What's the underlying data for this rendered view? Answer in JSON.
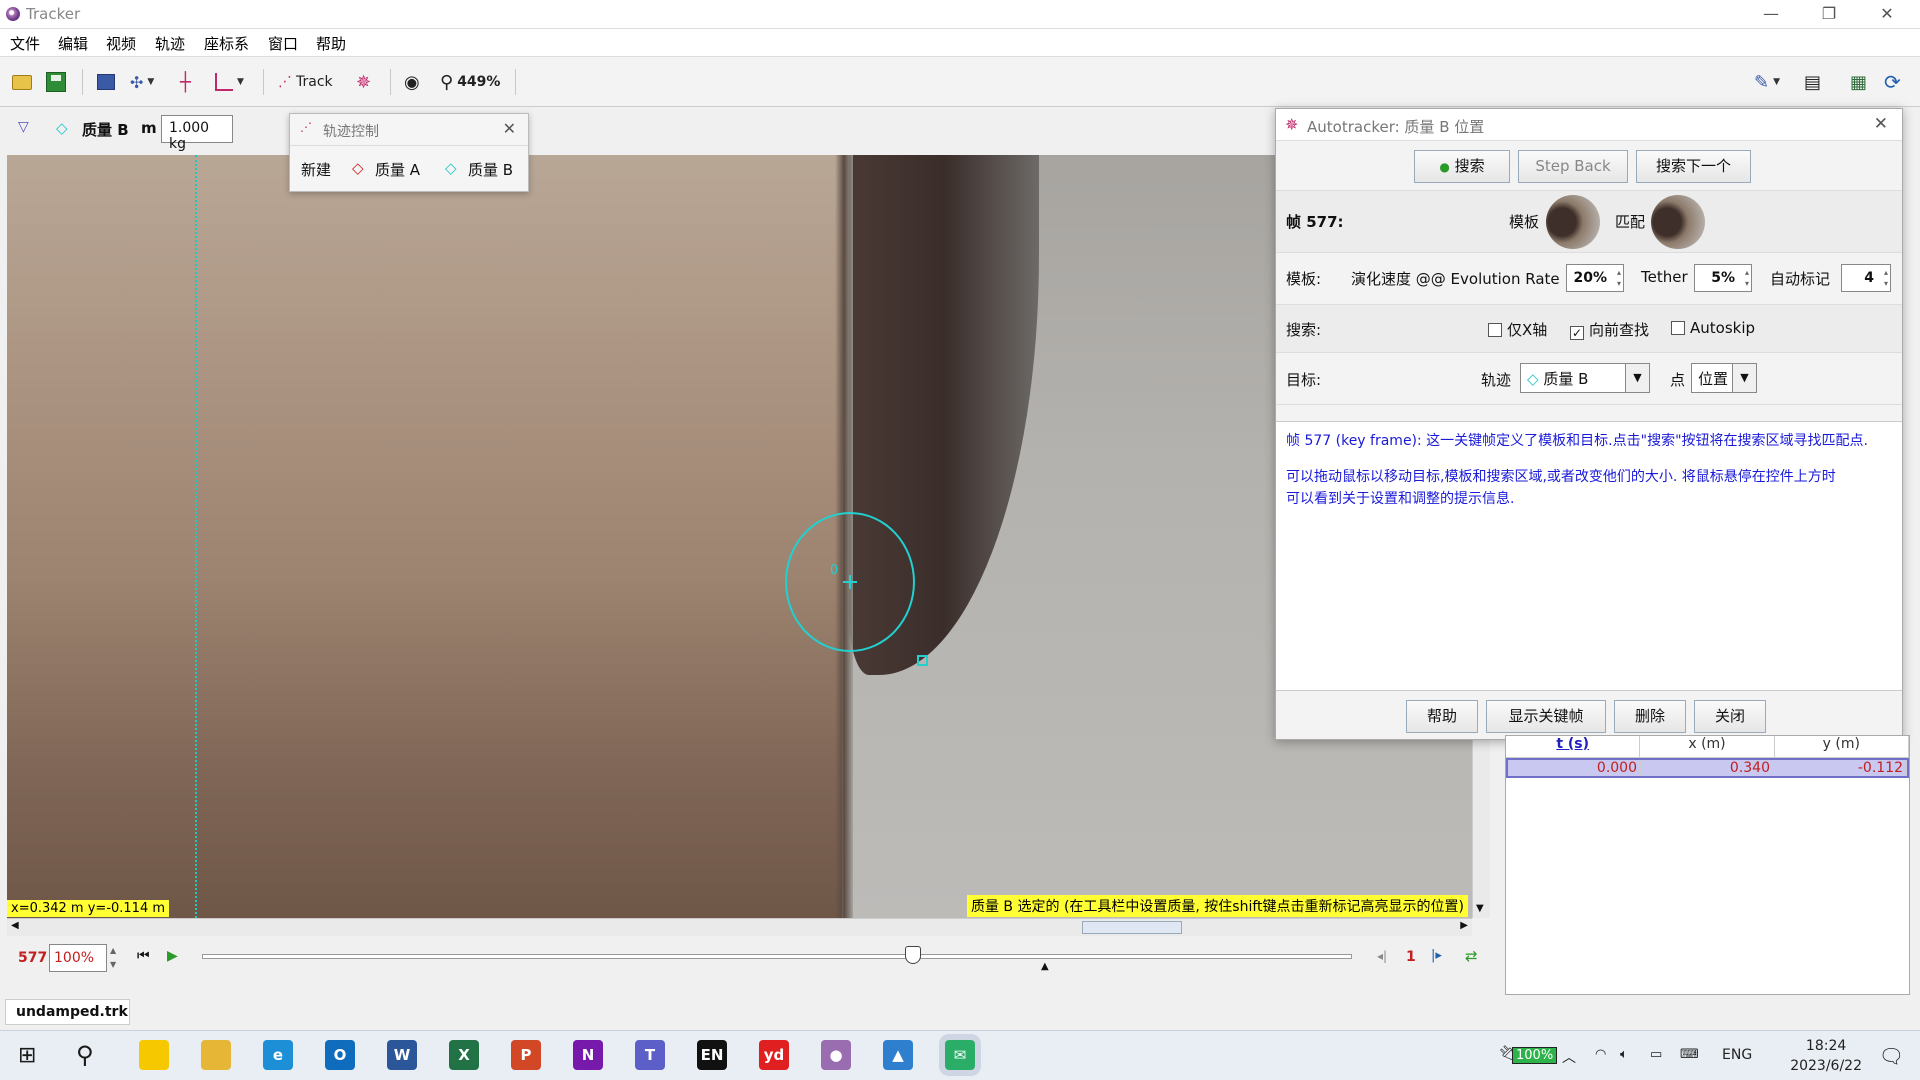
{
  "window": {
    "title": "Tracker",
    "minimize": "—",
    "restore": "❐",
    "close": "✕"
  },
  "menu": [
    "文件",
    "编辑",
    "视频",
    "轨迹",
    "座标系",
    "窗口",
    "帮助"
  ],
  "toolbar": {
    "track_label": "Track",
    "zoom": "449%"
  },
  "trackbar": {
    "track_name": "质量 B",
    "mass_label": "m",
    "mass_value": "1.000 kg"
  },
  "track_control": {
    "title": "轨迹控制",
    "new_label": "新建",
    "track_a": "质量 A",
    "track_b": "质量 B"
  },
  "canvas": {
    "marker_label": "0",
    "coords": "x=0.342 m  y=-0.114 m",
    "status": "质量 B 选定的 (在工具栏中设置质量, 按住shift键点击重新标记高亮显示的位置)"
  },
  "player": {
    "frame": "577",
    "speed": "100%",
    "step": "1"
  },
  "autotracker": {
    "title": "Autotracker: 质量 B 位置",
    "search_button": "搜索",
    "step_back_button": "Step Back",
    "search_next_button": "搜索下一个",
    "frame_label": "帧 577:",
    "template_label": "模板",
    "match_label": "匹配",
    "template_row_label": "模板:",
    "evolution_label": "演化速度 @@ Evolution Rate",
    "evolution_value": "20%",
    "tether_label": "Tether",
    "tether_value": "5%",
    "automark_label": "自动标记",
    "automark_value": "4",
    "search_row_label": "搜索:",
    "x_only_label": "仅X轴",
    "x_only_checked": false,
    "look_ahead_label": "向前查找",
    "look_ahead_checked": true,
    "autoskip_label": "Autoskip",
    "autoskip_checked": false,
    "target_row_label": "目标:",
    "track_label": "轨迹",
    "track_value": "质量 B",
    "point_label": "点",
    "point_value": "位置",
    "message_line1": "帧 577 (key frame): 这一关键帧定义了模板和目标.点击\"搜索\"按钮将在搜索区域寻找匹配点.",
    "message_line2": "可以拖动鼠标以移动目标,模板和搜索区域,或者改变他们的大小.  将鼠标悬停在控件上方时",
    "message_line3": "可以看到关于设置和调整的提示信息.",
    "help_button": "帮助",
    "show_keyframes_button": "显示关键帧",
    "delete_button": "删除",
    "close_button": "关闭"
  },
  "table": {
    "headers": [
      "t (s)",
      "x (m)",
      "y (m)"
    ],
    "rows": [
      [
        "0.000",
        "0.340",
        "-0.112"
      ]
    ]
  },
  "file_tab": "undamped.trk",
  "taskbar": {
    "apps": [
      {
        "name": "sticky-notes",
        "color": "#f5c800",
        "glyph": ""
      },
      {
        "name": "file-explorer",
        "color": "#e6b737",
        "glyph": ""
      },
      {
        "name": "edge",
        "color": "#1c8fd6",
        "glyph": "e"
      },
      {
        "name": "outlook",
        "color": "#0f6cbd",
        "glyph": "O"
      },
      {
        "name": "word",
        "color": "#2b579a",
        "glyph": "W"
      },
      {
        "name": "excel",
        "color": "#217346",
        "glyph": "X"
      },
      {
        "name": "powerpoint",
        "color": "#d24726",
        "glyph": "P"
      },
      {
        "name": "onenote",
        "color": "#7719aa",
        "glyph": "N"
      },
      {
        "name": "teams",
        "color": "#5b5fc7",
        "glyph": "T"
      },
      {
        "name": "en-dict",
        "color": "#111111",
        "glyph": "EN"
      },
      {
        "name": "youdao",
        "color": "#e02020",
        "glyph": "yd"
      },
      {
        "name": "tracker",
        "color": "#9a6cb0",
        "glyph": "●"
      },
      {
        "name": "photos",
        "color": "#2e80cf",
        "glyph": "▲"
      },
      {
        "name": "wechat",
        "color": "#2aae67",
        "glyph": "✉"
      }
    ],
    "battery": "100%",
    "lang": "ENG",
    "time": "18:24",
    "date": "2023/6/22"
  },
  "colors": {
    "accent_cyan": "#22d0d0",
    "status_yellow": "#ffff33",
    "frame_red": "#c02020",
    "message_blue": "#1a1ad8"
  }
}
